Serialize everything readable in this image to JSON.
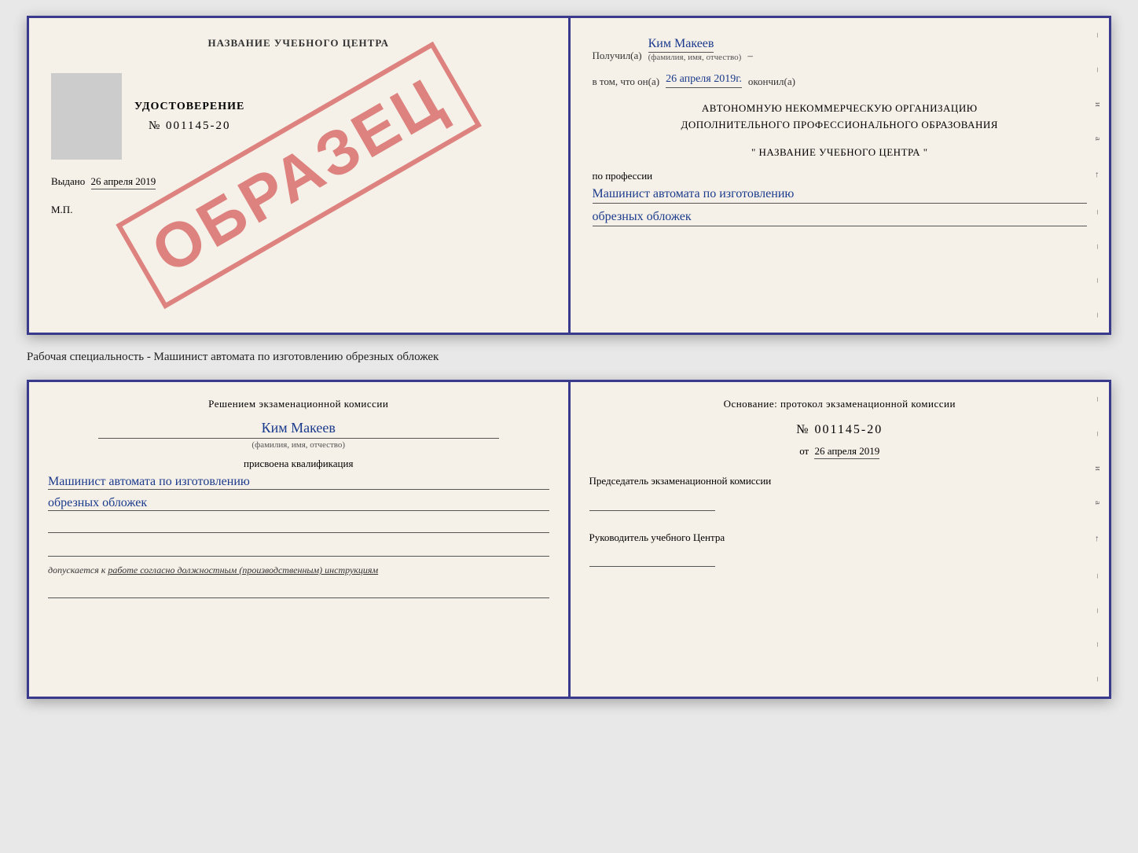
{
  "top_spread": {
    "left_page": {
      "school_name": "НАЗВАНИЕ УЧЕБНОГО ЦЕНТРА",
      "watermark": "ОБРАЗЕЦ",
      "cert_title": "УДОСТОВЕРЕНИЕ",
      "cert_number": "№ 001145-20",
      "issued_label": "Выдано",
      "issued_date": "26 апреля 2019",
      "mp_label": "М.П."
    },
    "right_page": {
      "recipient_label": "Получил(а)",
      "recipient_name": "Ким Макеев",
      "recipient_sublabel": "(фамилия, имя, отчество)",
      "date_prefix": "в том, что он(а)",
      "date_value": "26 апреля 2019г.",
      "date_suffix": "окончил(а)",
      "org_line1": "АВТОНОМНУЮ НЕКОММЕРЧЕСКУЮ ОРГАНИЗАЦИЮ",
      "org_line2": "ДОПОЛНИТЕЛЬНОГО ПРОФЕССИОНАЛЬНОГО ОБРАЗОВАНИЯ",
      "org_name": "\"  НАЗВАНИЕ УЧЕБНОГО ЦЕНТРА  \"",
      "profession_label": "по профессии",
      "profession_line1": "Машинист автомата по изготовлению",
      "profession_line2": "обрезных обложек"
    }
  },
  "separator": {
    "text": "Рабочая специальность - Машинист автомата по изготовлению обрезных обложек"
  },
  "bottom_spread": {
    "left_page": {
      "decision_header": "Решением экзаменационной комиссии",
      "person_name": "Ким Макеев",
      "person_sublabel": "(фамилия, имя, отчество)",
      "qualification_label": "присвоена квалификация",
      "qualification_line1": "Машинист автомата по изготовлению",
      "qualification_line2": "обрезных обложек",
      "allow_label": "допускается к",
      "allow_text": "работе согласно должностным (производственным) инструкциям"
    },
    "right_page": {
      "base_label": "Основание: протокол экзаменационной комиссии",
      "protocol_number": "№  001145-20",
      "protocol_date_prefix": "от",
      "protocol_date": "26 апреля 2019",
      "chairman_label": "Председатель экзаменационной комиссии",
      "head_label": "Руководитель учебного Центра"
    }
  }
}
